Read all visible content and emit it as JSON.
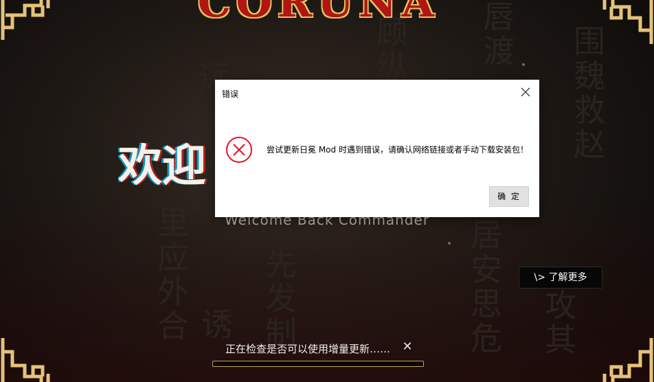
{
  "background": {
    "logo_text": "CORUNA",
    "welcome_cn": "欢迎",
    "welcome_en": "Welcome Back Commander",
    "vertical_texts": [
      "远交近",
      "唇渡",
      "顾纵",
      "围魏救赵",
      "先发制",
      "居安思危",
      "里应外合",
      "诱",
      "攻其"
    ]
  },
  "learn_more": {
    "label": "\\> 了解更多"
  },
  "update_status": {
    "text": "正在检查是否可以使用增量更新……",
    "close_glyph": "✕",
    "progress": 0
  },
  "dialog": {
    "title": "错误",
    "message": "尝试更新日冕 Mod 时遇到错误，请确认网络链接或者手动下载安装包！",
    "ok_label": "确 定",
    "icon": "error-circle-x-icon",
    "icon_color": "#e81123"
  },
  "colors": {
    "accent_gold": "#c9a24e",
    "logo_red": "#b01613"
  }
}
